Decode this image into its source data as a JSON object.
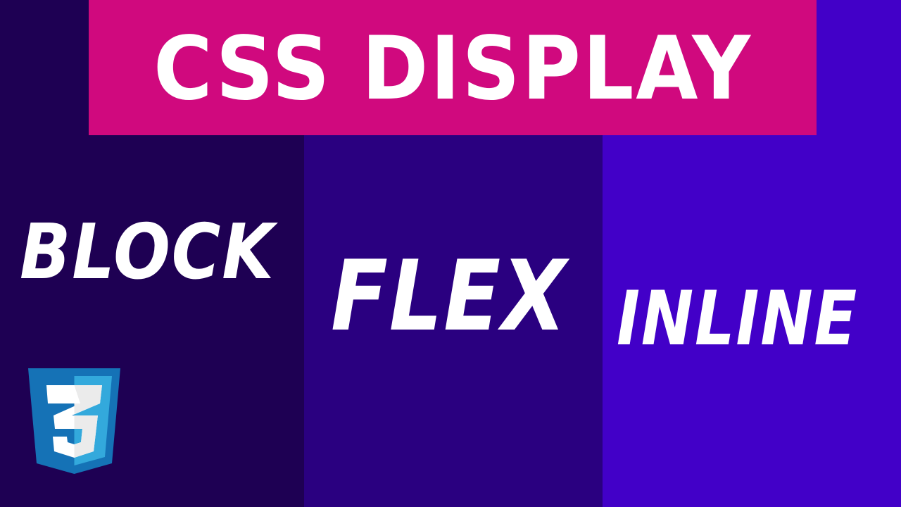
{
  "title": "CSS DISPLAY",
  "words": {
    "block": "BLOCK",
    "flex": "FLEX",
    "inline": "INLINE"
  },
  "logo": {
    "icon": "css3-logo-icon",
    "number": "3"
  },
  "colors": {
    "banner": "#d0097e",
    "column_left": "#1e0053",
    "column_middle": "#2a0080",
    "column_right": "#4200c8",
    "text": "#ffffff",
    "logo_dark": "#1572b6",
    "logo_light": "#33a9dc"
  }
}
